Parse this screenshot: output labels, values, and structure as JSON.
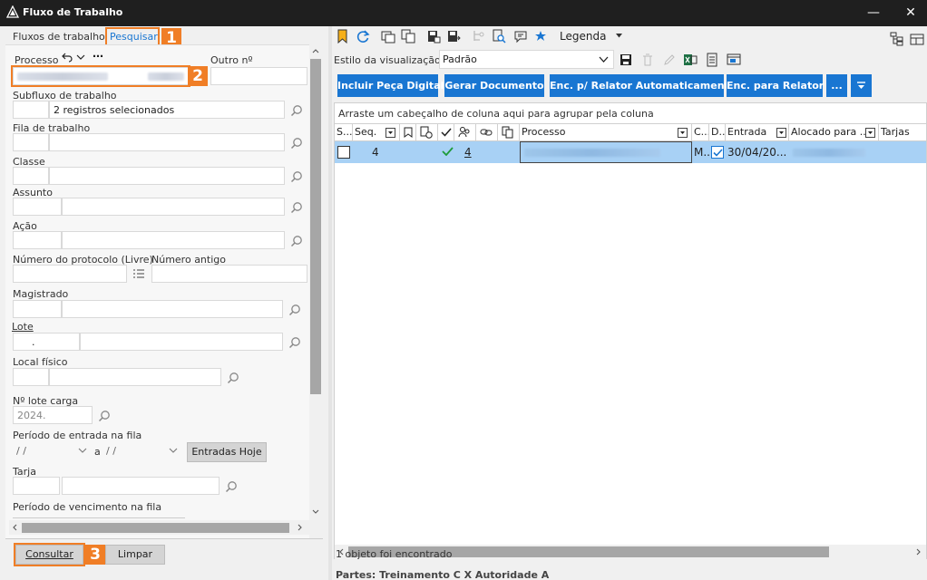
{
  "window": {
    "title": "Fluxo de Trabalho"
  },
  "left": {
    "tabs": [
      "Fluxos de trabalho",
      "Pesquisar"
    ],
    "callouts": [
      "1",
      "2",
      "3"
    ],
    "processo_label": "Processo",
    "outro_label": "Outro nº",
    "subfluxo_label": "Subfluxo de trabalho",
    "subfluxo_value": "2 registros selecionados",
    "fila_label": "Fila de trabalho",
    "classe_label": "Classe",
    "assunto_label": "Assunto",
    "acao_label": "Ação",
    "protocolo_label": "Número do protocolo (Livre)",
    "antigo_label": "Número antigo",
    "magistrado_label": "Magistrado",
    "lote_label": "Lote",
    "lote_sep": ".",
    "local_label": "Local físico",
    "lote_carga_label": "Nº lote carga",
    "lote_carga_value": "2024.",
    "periodo_entrada_label": "Período de entrada na fila",
    "date_placeholder": " / /",
    "a_label": "a",
    "entradas_hoje": "Entradas Hoje",
    "tarja_label": "Tarja",
    "periodo_venc_label": "Período de vencimento na fila",
    "consultar": "Consultar",
    "limpar": "Limpar"
  },
  "right": {
    "legenda": "Legenda",
    "estilo_label": "Estilo da visualização",
    "estilo_value": "Padrão",
    "buttons": [
      "Incluir Peça Digital",
      "Gerar Documento",
      "Enc. p/ Relator Automaticamente",
      "Enc. para Relator",
      "..."
    ],
    "group_hint": "Arraste um cabeçalho de coluna aqui para agrupar pela coluna",
    "columns": [
      "S...",
      "Seq.",
      "Processo",
      "C...",
      "D...",
      "Entrada",
      "Alocado para ...",
      "Tarjas"
    ],
    "row": {
      "seq": "4",
      "count": "4",
      "c": "M...",
      "entrada": "30/04/20..."
    },
    "status": "1 objeto foi encontrado",
    "partes": "Partes: Treinamento C  X  Autoridade A"
  },
  "colors": {
    "accent": "#1976d2",
    "callout": "#f07e26",
    "selected_row": "#a8d1f5",
    "titlebar": "#1f1f1f"
  }
}
